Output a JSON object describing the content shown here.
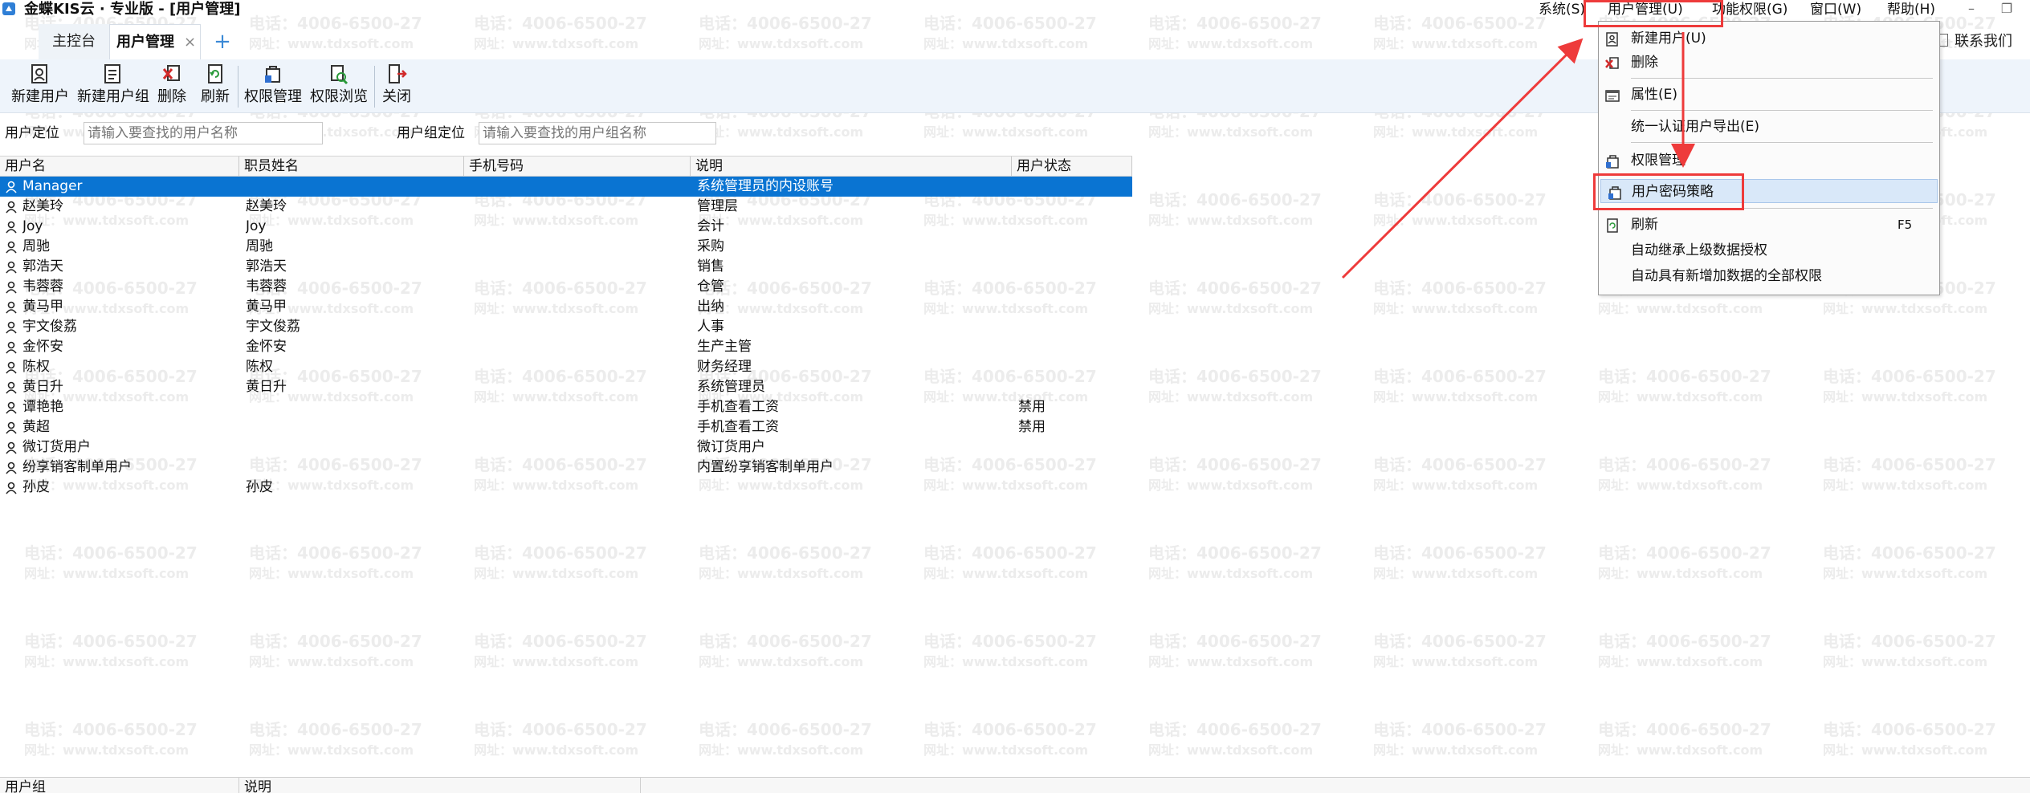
{
  "window": {
    "title": "金蝶KIS云 · 专业版 - [用户管理]",
    "menu": [
      "系统(S)",
      "用户管理(U)",
      "功能权限(G)",
      "窗口(W)",
      "帮助(H)"
    ],
    "controls": [
      "–",
      "❐"
    ]
  },
  "tabs": {
    "main": "主控台",
    "users": "用户管理",
    "close": "×",
    "add": "+"
  },
  "contact": "联系我们",
  "toolbar": {
    "new_user": "新建用户",
    "new_group": "新建用户组",
    "delete": "删除",
    "refresh": "刷新",
    "permission_mgmt": "权限管理",
    "permission_browse": "权限浏览",
    "close": "关闭"
  },
  "search": {
    "user_label": "用户定位",
    "user_placeholder": "请输入要查找的用户名称",
    "group_label": "用户组定位",
    "group_placeholder": "请输入要查找的用户组名称"
  },
  "table": {
    "columns": [
      "用户名",
      "职员姓名",
      "手机号码",
      "说明",
      "用户状态"
    ],
    "rows": [
      {
        "name": "Manager",
        "staff": "",
        "phone": "",
        "desc": "系统管理员的内设账号",
        "status": ""
      },
      {
        "name": "赵美玲",
        "staff": "赵美玲",
        "phone": "",
        "desc": "管理层",
        "status": ""
      },
      {
        "name": "Joy",
        "staff": "Joy",
        "phone": "",
        "desc": "会计",
        "status": ""
      },
      {
        "name": "周驰",
        "staff": "周驰",
        "phone": "",
        "desc": "采购",
        "status": ""
      },
      {
        "name": "郭浩天",
        "staff": "郭浩天",
        "phone": "",
        "desc": "销售",
        "status": ""
      },
      {
        "name": "韦蓉蓉",
        "staff": "韦蓉蓉",
        "phone": "",
        "desc": "仓管",
        "status": ""
      },
      {
        "name": "黄马甲",
        "staff": "黄马甲",
        "phone": "",
        "desc": "出纳",
        "status": ""
      },
      {
        "name": "宇文俊荔",
        "staff": "宇文俊荔",
        "phone": "",
        "desc": "人事",
        "status": ""
      },
      {
        "name": "金怀安",
        "staff": "金怀安",
        "phone": "",
        "desc": "生产主管",
        "status": ""
      },
      {
        "name": "陈权",
        "staff": "陈权",
        "phone": "",
        "desc": "财务经理",
        "status": ""
      },
      {
        "name": "黄日升",
        "staff": "黄日升",
        "phone": "",
        "desc": "系统管理员",
        "status": ""
      },
      {
        "name": "谭艳艳",
        "staff": "",
        "phone": "",
        "desc": "手机查看工资",
        "status": "禁用"
      },
      {
        "name": "黄超",
        "staff": "",
        "phone": "",
        "desc": "手机查看工资",
        "status": "禁用"
      },
      {
        "name": "微订货用户",
        "staff": "",
        "phone": "",
        "desc": "微订货用户",
        "status": ""
      },
      {
        "name": "纷享销客制单用户",
        "staff": "",
        "phone": "",
        "desc": "内置纷享销客制单用户",
        "status": ""
      },
      {
        "name": "孙皮",
        "staff": "孙皮",
        "phone": "",
        "desc": "",
        "status": ""
      }
    ],
    "selected_index": 0
  },
  "bottom": {
    "columns": [
      "用户组",
      "说明"
    ]
  },
  "dropdown": {
    "items": [
      {
        "label": "新建用户(U)",
        "icon": "new-user-icon"
      },
      {
        "label": "删除",
        "icon": "delete-icon"
      },
      {
        "label": "属性(E)",
        "icon": "properties-icon"
      },
      {
        "label": "统一认证用户导出(E)",
        "icon": ""
      },
      {
        "label": "权限管理",
        "icon": "permission-icon"
      },
      {
        "label": "用户密码策略",
        "icon": "password-policy-icon"
      },
      {
        "label": "刷新",
        "icon": "refresh-icon",
        "shortcut": "F5"
      },
      {
        "label": "自动继承上级数据授权",
        "icon": ""
      },
      {
        "label": "自动具有新增加数据的全部权限",
        "icon": ""
      }
    ]
  },
  "watermark": {
    "phone": "电话：4006-6500-27",
    "site": "网址：www.tdxsoft.com"
  },
  "colors": {
    "selection": "#0a74d2",
    "annotation": "#ee3b3b",
    "toolbar_bg": "#eef4fb"
  }
}
